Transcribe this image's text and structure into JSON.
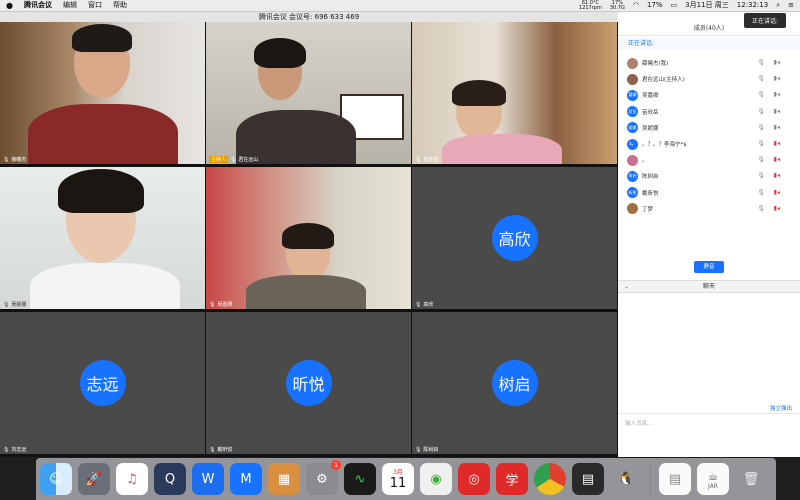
{
  "menubar": {
    "apple": "",
    "items": [
      "腾讯会议",
      "编辑",
      "窗口",
      "帮助"
    ],
    "weather": "61.0°C",
    "weather_sub": "1217rpm",
    "cpu": "17%",
    "cpu_sub": "30.7G",
    "battery": "17%",
    "date": "3月11日 周三",
    "time": "12:32:13"
  },
  "window": {
    "title": "腾讯会议 会议号: 696 633 469"
  },
  "tiles": [
    {
      "name": "薛曦杰"
    },
    {
      "host_tag": "主持人",
      "name": "君在远山"
    },
    {
      "name": "苗欣岳"
    },
    {
      "name": "吴妮娜"
    },
    {
      "name": "吴嘉卿"
    },
    {
      "name": "高欣",
      "avatar": "高欣"
    },
    {
      "name": "刘志远",
      "avatar": "志远"
    },
    {
      "name": "戴昕悦",
      "avatar": "昕悦"
    },
    {
      "name": "陈树启",
      "avatar": "树启"
    }
  ],
  "panel": {
    "tooltip": "正在讲话:",
    "header": "成员(40人)",
    "speaking_label": "正在讲话:",
    "participants": [
      {
        "name": "薛曦杰(我)",
        "avatar": "",
        "color": "#b08070"
      },
      {
        "name": "君在远山(主持人)",
        "avatar": "",
        "color": "#906050"
      },
      {
        "name": "吴嘉卿",
        "avatar": "嘉卿",
        "color": "#1672ff"
      },
      {
        "name": "苗欣岳",
        "avatar": "欣岳",
        "color": "#1672ff"
      },
      {
        "name": "吴妮娜",
        "avatar": "妮娜",
        "color": "#1672ff"
      },
      {
        "name": "。？。？李海宁*$",
        "avatar": "$。",
        "color": "#1672ff"
      },
      {
        "name": "。",
        "avatar": "",
        "color": "#c87090"
      },
      {
        "name": "陈树启",
        "avatar": "树启",
        "color": "#1672ff"
      },
      {
        "name": "戴昕悦",
        "avatar": "昕悦",
        "color": "#1672ff"
      },
      {
        "name": "丁梦",
        "avatar": "",
        "color": "#a07040"
      }
    ],
    "mute_all": "静音",
    "chat_label": "聊天",
    "popout": "独立弹出",
    "chat_placeholder": "输入消息..."
  },
  "dock": {
    "calendar_month": "3月",
    "calendar_day": "11",
    "settings_badge": "1",
    "jar_label": "JAR"
  }
}
